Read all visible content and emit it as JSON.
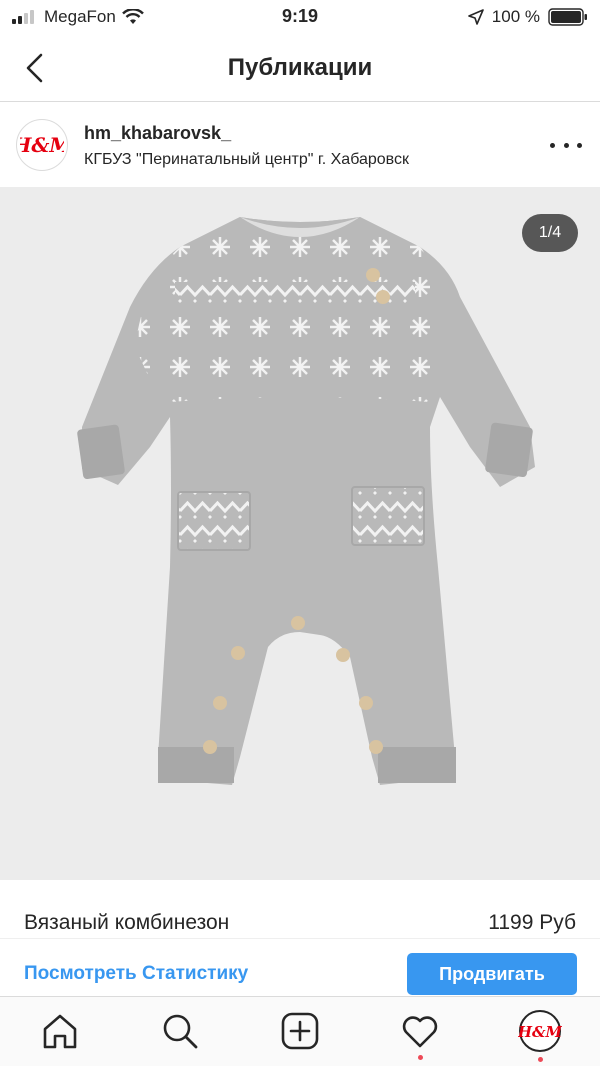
{
  "status_bar": {
    "carrier": "MegaFon",
    "time": "9:19",
    "battery_percent": "100 %"
  },
  "nav": {
    "title": "Публикации",
    "back_icon": "chevron-left-icon"
  },
  "post": {
    "username": "hm_khabarovsk_",
    "location": "КГБУЗ \"Перинатальный центр\" г. Хабаровск",
    "avatar_logo": "H&M",
    "image_counter": "1/4",
    "product_name": "Вязаный комбинезон",
    "price": "1199 Руб"
  },
  "actions": {
    "stats_link": "Посмотреть Статистику",
    "promote_button": "Продвигать"
  },
  "tab_bar": {
    "items": [
      "home-icon",
      "search-icon",
      "new-post-icon",
      "activity-heart-icon",
      "profile-avatar"
    ]
  },
  "colors": {
    "accent_blue": "#3897f0",
    "notification_red": "#ed4956",
    "image_background": "#ececec",
    "garment_gray": "#b9b9b9",
    "hm_red": "#e50010"
  }
}
